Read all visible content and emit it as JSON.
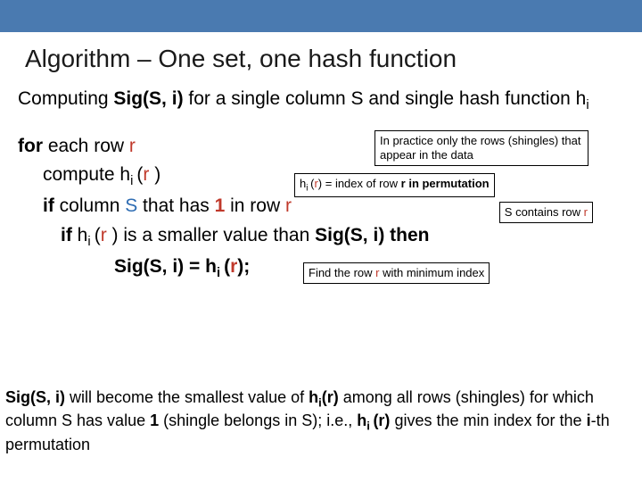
{
  "title": "Algorithm – One set, one hash function",
  "intro": {
    "prefix": "Computing ",
    "sig": "Sig(S, i)",
    "rest1": " for a single column S and single hash function h",
    "sub": "i"
  },
  "algo": {
    "l1a": "for ",
    "l1b": "each row ",
    "l1c": "r",
    "l2a": "compute h",
    "l2sub": "i ",
    "l2b": "(",
    "l2c": "r ",
    "l2d": ")",
    "l3a": "if ",
    "l3b": "column ",
    "l3c": "S",
    "l3d": " that has ",
    "l3e": "1",
    "l3f": " in row ",
    "l3g": "r",
    "l4a": "if ",
    "l4b": "h",
    "l4sub": "i ",
    "l4c": "(",
    "l4d": "r ",
    "l4e": ") is a smaller value than ",
    "l4f": "Sig(S, i) then",
    "l5a": "Sig(S, i) = h",
    "l5sub": "i ",
    "l5b": "(",
    "l5c": "r",
    "l5d": ");"
  },
  "notes": {
    "n1": "In practice only the rows (shingles) that appear in the data",
    "n2a": "h",
    "n2sub": "i ",
    "n2b": "(",
    "n2c": "r",
    "n2d": ") = index of row ",
    "n2e": "r",
    "n2f": " in permutation",
    "n3a": "S contains row ",
    "n3b": "r",
    "n4a": "Find the row ",
    "n4b": "r",
    "n4c": " with minimum index"
  },
  "footer": {
    "t1": "Sig(S, i)",
    "t2": " will become the smallest value of ",
    "t3": "h",
    "t3sub": "i",
    "t4": "(r)",
    "t5": " among all rows (shingles) for which column S has value ",
    "t6": "1",
    "t7": " (shingle belongs in S); i.e., ",
    "t8": "h",
    "t8sub": "i ",
    "t9": "(r)",
    "t10": " gives the min index for the ",
    "t11": "i",
    "t12": "-th permutation"
  }
}
